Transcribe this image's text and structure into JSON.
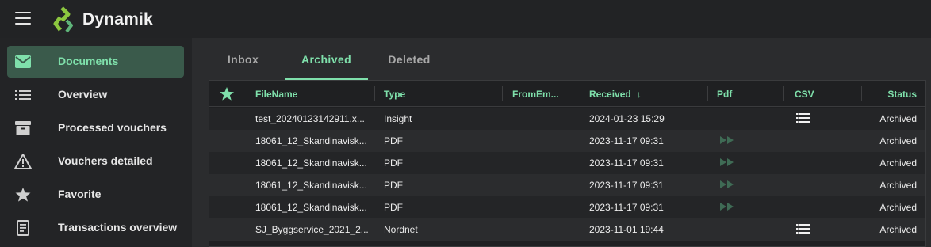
{
  "app": {
    "title": "Dynamik"
  },
  "sidebar": {
    "items": [
      {
        "label": "Documents",
        "icon": "mail-icon",
        "active": true
      },
      {
        "label": "Overview",
        "icon": "list-icon",
        "active": false
      },
      {
        "label": "Processed vouchers",
        "icon": "archive-box-icon",
        "active": false
      },
      {
        "label": "Vouchers detailed",
        "icon": "warning-triangle-icon",
        "active": false
      },
      {
        "label": "Favorite",
        "icon": "star-icon",
        "active": false
      },
      {
        "label": "Transactions overview",
        "icon": "receipt-icon",
        "active": false
      }
    ]
  },
  "tabs": [
    {
      "label": "Inbox",
      "active": false
    },
    {
      "label": "Archived",
      "active": true
    },
    {
      "label": "Deleted",
      "active": false
    }
  ],
  "table": {
    "columns": {
      "favorite": "",
      "filename": "FileName",
      "type": "Type",
      "fromemail": "FromEm...",
      "received": "Received",
      "received_sort": "↓",
      "pdf": "Pdf",
      "csv": "CSV",
      "status": "Status"
    },
    "rows": [
      {
        "filename": "test_20240123142911.x...",
        "type": "Insight",
        "from": "",
        "received": "2024-01-23 15:29",
        "pdf": false,
        "csv": true,
        "status": "Archived"
      },
      {
        "filename": "18061_12_Skandinavisk...",
        "type": "PDF",
        "from": "",
        "received": "2023-11-17 09:31",
        "pdf": true,
        "csv": false,
        "status": "Archived"
      },
      {
        "filename": "18061_12_Skandinavisk...",
        "type": "PDF",
        "from": "",
        "received": "2023-11-17 09:31",
        "pdf": true,
        "csv": false,
        "status": "Archived"
      },
      {
        "filename": "18061_12_Skandinavisk...",
        "type": "PDF",
        "from": "",
        "received": "2023-11-17 09:31",
        "pdf": true,
        "csv": false,
        "status": "Archived"
      },
      {
        "filename": "18061_12_Skandinavisk...",
        "type": "PDF",
        "from": "",
        "received": "2023-11-17 09:31",
        "pdf": true,
        "csv": false,
        "status": "Archived"
      },
      {
        "filename": "SJ_Byggservice_2021_2...",
        "type": "Nordnet",
        "from": "",
        "received": "2023-11-01 19:44",
        "pdf": false,
        "csv": true,
        "status": "Archived"
      }
    ]
  },
  "colors": {
    "accent": "#7fe0ab",
    "active_bg": "#3a5a4b",
    "pdf_icon": "#3f6b55"
  }
}
